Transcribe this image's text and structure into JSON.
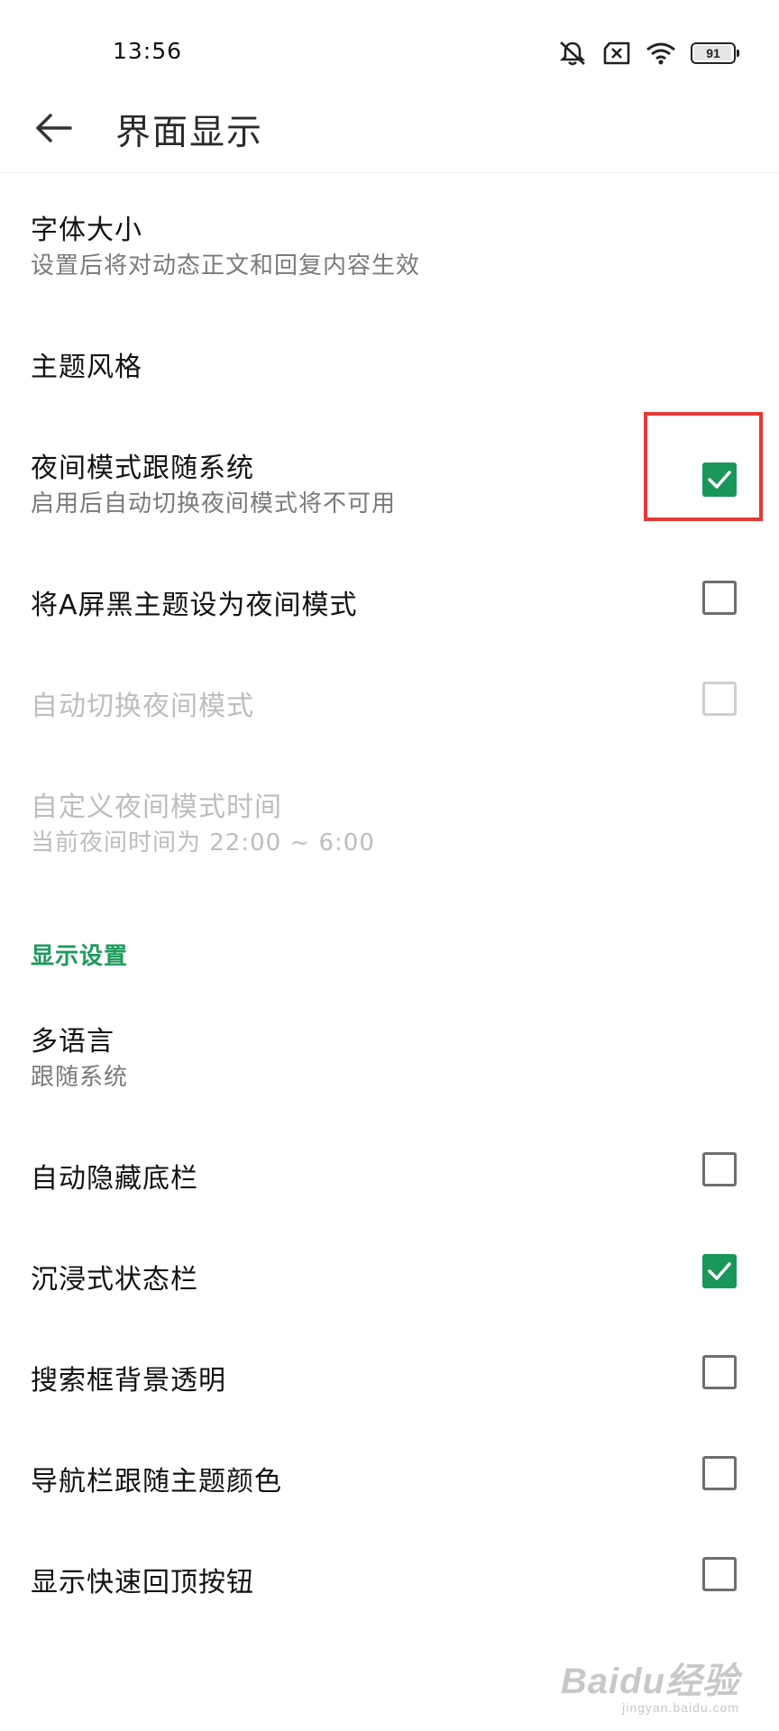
{
  "status_bar": {
    "time": "13:56",
    "battery": "91",
    "icons": [
      "mute-bell-icon",
      "no-sim-icon",
      "wifi-icon",
      "battery-icon"
    ]
  },
  "app_bar": {
    "back_icon": "back-arrow-icon",
    "title": "界面显示"
  },
  "settings": {
    "font_size": {
      "title": "字体大小",
      "subtitle": "设置后将对动态正文和回复内容生效"
    },
    "theme_style": {
      "title": "主题风格"
    },
    "night_follow_system": {
      "title": "夜间模式跟随系统",
      "subtitle": "启用后自动切换夜间模式将不可用",
      "checked": true
    },
    "a_screen_black": {
      "title": "将A屏黑主题设为夜间模式",
      "checked": false
    },
    "auto_night": {
      "title": "自动切换夜间模式",
      "checked": false,
      "disabled": true
    },
    "custom_night_time": {
      "title": "自定义夜间模式时间",
      "subtitle": "当前夜间时间为 22:00 ~ 6:00",
      "disabled": true
    }
  },
  "display_section": {
    "header": "显示设置",
    "language": {
      "title": "多语言",
      "subtitle": "跟随系统"
    },
    "auto_hide_bottom_bar": {
      "title": "自动隐藏底栏",
      "checked": false
    },
    "immersive_status_bar": {
      "title": "沉浸式状态栏",
      "checked": true
    },
    "search_bg_transparent": {
      "title": "搜索框背景透明",
      "checked": false
    },
    "nav_bar_follow_theme": {
      "title": "导航栏跟随主题颜色",
      "checked": false
    },
    "show_back_to_top": {
      "title": "显示快速回顶按钮",
      "checked": false
    }
  },
  "watermark": {
    "brand": "Baidu经验",
    "url": "jingyan.baidu.com"
  },
  "colors": {
    "accent": "#19975a",
    "section_header": "#1e9a5c",
    "highlight": "#e53935"
  }
}
